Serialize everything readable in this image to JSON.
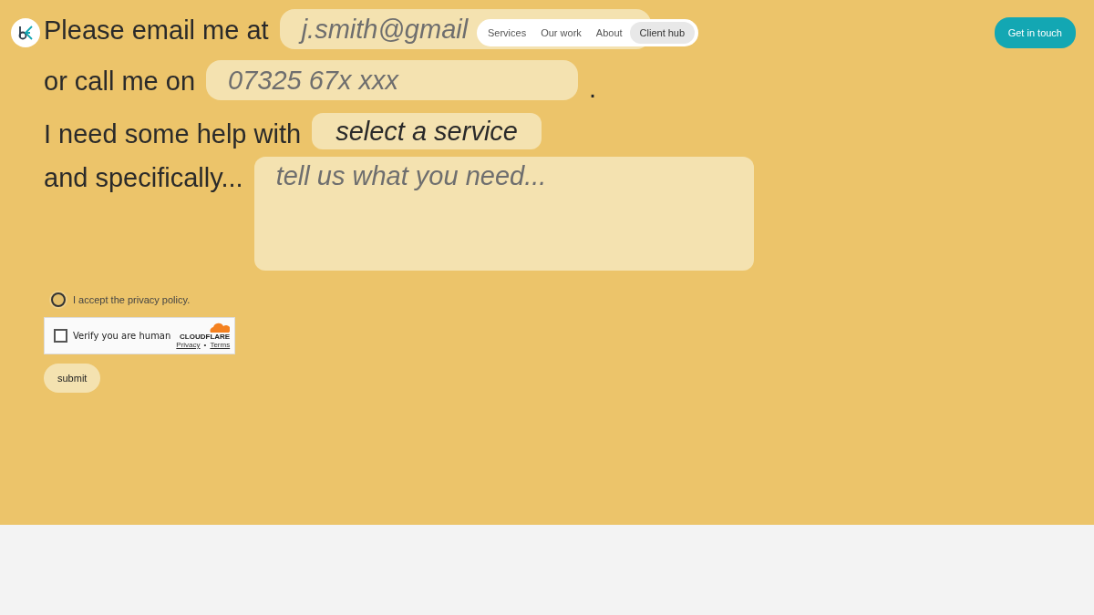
{
  "header": {
    "nav": [
      {
        "label": "Services",
        "selected": false
      },
      {
        "label": "Our work",
        "selected": false
      },
      {
        "label": "About",
        "selected": false
      },
      {
        "label": "Client hub",
        "selected": true
      }
    ],
    "cta": "Get in touch"
  },
  "form": {
    "lines": [
      {
        "text": "Please email me at",
        "kind": "input",
        "placeholder": "j.smith@gmail"
      },
      {
        "text": "or call me on",
        "kind": "input",
        "placeholder": "07325 67x xxx",
        "after": "."
      },
      {
        "text": "I need some help with",
        "kind": "select",
        "value": "select a service"
      },
      {
        "text": "and specifically...",
        "kind": "textarea",
        "placeholder": "tell us what you need..."
      }
    ],
    "privacy": {
      "label": "I accept the privacy policy.",
      "checked": false
    },
    "captcha": {
      "label": "Verify you are human",
      "checked": false,
      "brand": "CLOUDFLARE",
      "links": [
        "Privacy",
        "Terms"
      ],
      "separator": "•"
    },
    "submit": "submit"
  }
}
